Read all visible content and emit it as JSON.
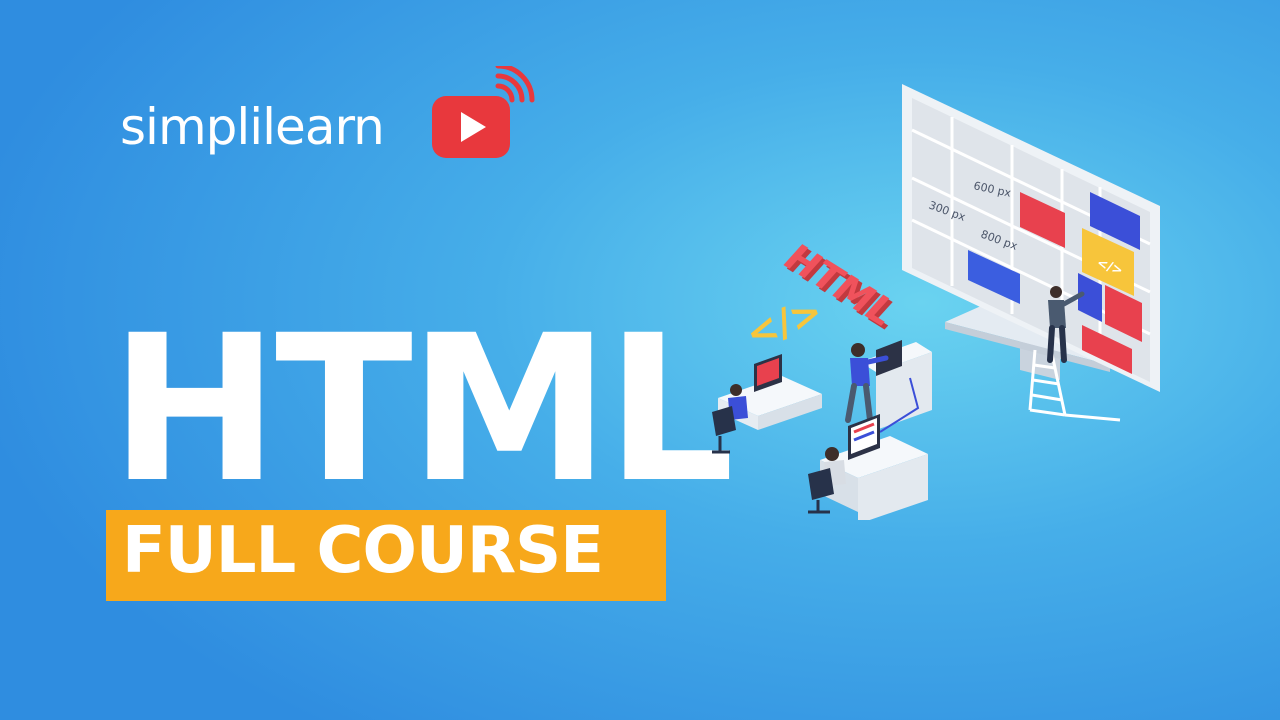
{
  "brand": {
    "name": "simplilearn",
    "play_icon": "youtube-play-icon",
    "broadcast_icon": "broadcast-waves-icon"
  },
  "title": "HTML",
  "subtitle": "FULL COURSE",
  "illustration": {
    "labels": {
      "px600": "600 px",
      "px300": "300 px",
      "px800": "800 px",
      "code_tag": "</>",
      "html_word": "HTML",
      "code_arrows": "</>"
    }
  },
  "colors": {
    "background_left": "#2e8fe0",
    "background_right": "#5cc6ee",
    "banner": "#f7a81b",
    "brand_red": "#e8383d",
    "block_red": "#e8414e",
    "block_blue": "#3b4fd8",
    "block_yellow": "#f7c53b"
  }
}
